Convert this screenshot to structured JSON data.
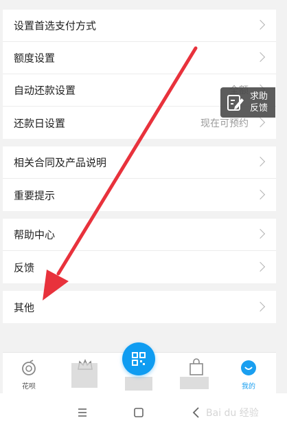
{
  "settings": {
    "group1": [
      {
        "label": "设置首选支付方式",
        "value": ""
      },
      {
        "label": "额度设置",
        "value": ""
      },
      {
        "label": "自动还款设置",
        "value": "全额"
      },
      {
        "label": "还款日设置",
        "value": "现在可预约"
      }
    ],
    "group2": [
      {
        "label": "相关合同及产品说明",
        "value": ""
      },
      {
        "label": "重要提示",
        "value": ""
      }
    ],
    "group3": [
      {
        "label": "帮助中心",
        "value": ""
      },
      {
        "label": "反馈",
        "value": ""
      }
    ],
    "group4": [
      {
        "label": "其他",
        "value": ""
      }
    ]
  },
  "feedback_badge": {
    "text": "求助反馈",
    "icon": "edit-note-icon"
  },
  "tabbar": {
    "tabs": [
      {
        "label": "花呗",
        "icon": "huabei-icon",
        "active": false
      },
      {
        "label": "",
        "icon": "crown-icon",
        "active": false
      },
      {
        "label": "",
        "icon": "scan-icon",
        "active": false
      },
      {
        "label": "",
        "icon": "shopping-bag-icon",
        "active": false
      },
      {
        "label": "我的",
        "icon": "smile-icon",
        "active": true
      }
    ],
    "active_color": "#1a9ff0"
  },
  "system_nav": {
    "icons": [
      "menu-icon",
      "home-square-icon",
      "back-icon"
    ]
  },
  "watermark": "Bai du 经验",
  "annotation": {
    "arrow_color": "#e8323c"
  }
}
